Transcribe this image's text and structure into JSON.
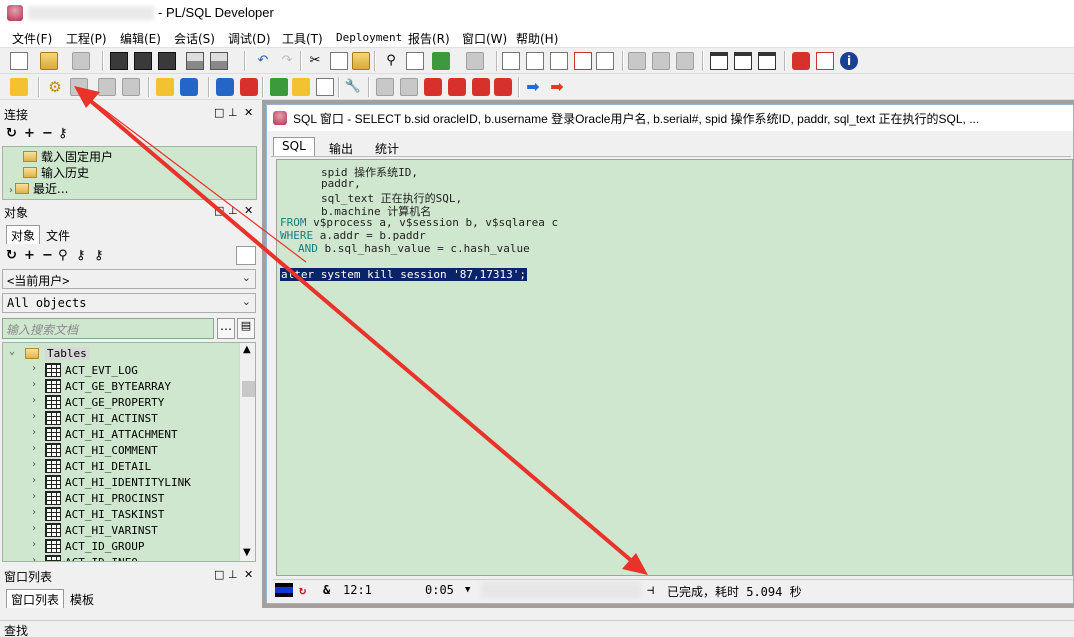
{
  "window": {
    "title": "- PL/SQL Developer"
  },
  "menu": {
    "items": [
      "文件(F)",
      "工程(P)",
      "编辑(E)",
      "会话(S)",
      "调试(D)",
      "工具(T)",
      "Deployment",
      "报告(R)",
      "窗口(W)",
      "帮助(H)"
    ]
  },
  "connection_panel": {
    "title": "连接",
    "items": [
      "载入固定用户",
      "输入历史",
      "最近..."
    ]
  },
  "objects_panel": {
    "title": "对象",
    "tabs": [
      "对象",
      "文件"
    ],
    "user_select": "<当前用户>",
    "filter_select": "All objects",
    "search_placeholder": "输入搜索文档",
    "root_folder": "Tables",
    "tables": [
      "ACT_EVT_LOG",
      "ACT_GE_BYTEARRAY",
      "ACT_GE_PROPERTY",
      "ACT_HI_ACTINST",
      "ACT_HI_ATTACHMENT",
      "ACT_HI_COMMENT",
      "ACT_HI_DETAIL",
      "ACT_HI_IDENTITYLINK",
      "ACT_HI_PROCINST",
      "ACT_HI_TASKINST",
      "ACT_HI_VARINST",
      "ACT_ID_GROUP",
      "ACT_ID_INFO"
    ]
  },
  "window_list_panel": {
    "title": "窗口列表",
    "tabs": [
      "窗口列表",
      "模板"
    ]
  },
  "sql_window": {
    "title": "SQL 窗口 - SELECT b.sid oracleID, b.username 登录Oracle用户名, b.serial#, spid 操作系统ID, paddr, sql_text 正在执行的SQL, ...",
    "tabs": [
      "SQL",
      "输出",
      "统计"
    ],
    "code": {
      "line1": "spid 操作系统ID,",
      "line2": "paddr,",
      "line3": "sql_text 正在执行的SQL,",
      "line4": "b.machine 计算机名",
      "from_kw": "FROM",
      "from_rest": " v$process a, v$session b, v$sqlarea c",
      "where_kw": "WHERE",
      "where_rest": " a.addr = b.paddr",
      "and_kw": "AND",
      "and_rest": " b.sql_hash_value = c.hash_value",
      "selected": "alter system kill session '87,17313';"
    },
    "status": {
      "cursor": "12:1",
      "time": "0:05",
      "message": "已完成，耗时 5.094 秒"
    }
  },
  "bottom_status": {
    "text": "查找"
  },
  "colors": {
    "editor_bg": "#cfe6cf",
    "selection_bg": "#0a246a",
    "keyword": "#1a7c7c",
    "annotation_arrow": "#e8332a"
  }
}
